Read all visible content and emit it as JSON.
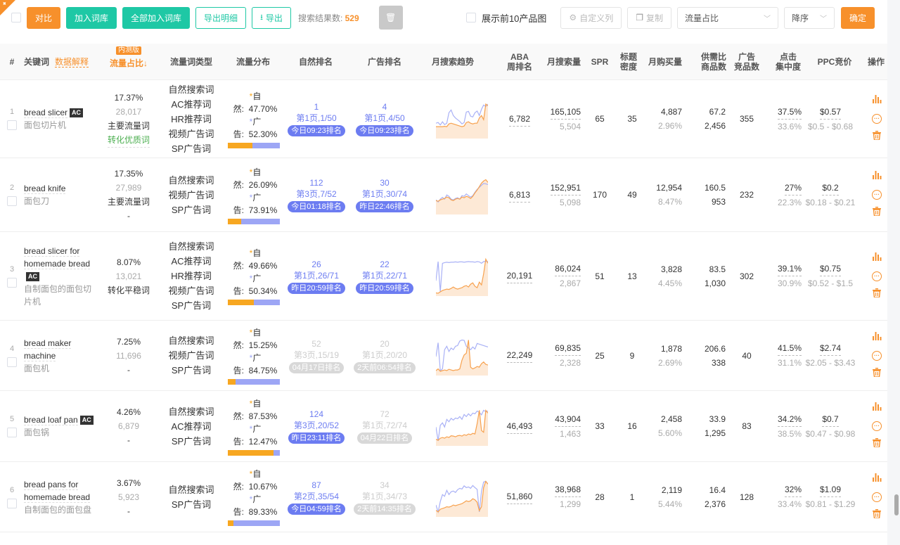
{
  "toolbar": {
    "compare_label": "对比",
    "add_to_lib_label": "加入词库",
    "add_all_to_lib_label": "全部加入词库",
    "export_detail_label": "导出明细",
    "export_label": "导出",
    "result_count_label": "搜索结果数:",
    "result_count_value": "529",
    "show_top10_label": "展示前10产品图",
    "custom_columns_label": "自定义列",
    "copy_label": "复制",
    "sort_field_value": "流量占比",
    "sort_order_value": "降序",
    "confirm_label": "确定"
  },
  "colors": {
    "accent_orange": "#f7902b",
    "accent_green": "#1ec8a5",
    "rank_blue": "#6c7cf1",
    "organic_bar": "#f7a721",
    "ad_bar": "#9da6f5"
  },
  "header": {
    "index": "#",
    "keyword": "关键词",
    "data_explain": "数据解释",
    "beta_badge": "内测版",
    "traffic_share": "流量占比↓",
    "traffic_type": "流量词类型",
    "traffic_dist": "流量分布",
    "organic_rank": "自然排名",
    "ad_rank": "广告排名",
    "monthly_trend": "月搜索趋势",
    "aba_rank_1": "ABA",
    "aba_rank_2": "周排名",
    "monthly_search": "月搜索量",
    "spr": "SPR",
    "title_density_1": "标题",
    "title_density_2": "密度",
    "monthly_purchase": "月购买量",
    "supply_demand_1": "供需比",
    "supply_demand_2": "商品数",
    "ad_products_1": "广告",
    "ad_products_2": "竞品数",
    "click_conc_1": "点击",
    "click_conc_2": "集中度",
    "ppc": "PPC竞价",
    "ops": "操作"
  },
  "dist_labels": {
    "organic": "自然:",
    "ad": "广告:"
  },
  "rows": [
    {
      "index": "1",
      "keyword": "bread slicer",
      "ac": true,
      "keyword_cn": "面包切片机",
      "share": "17.37%",
      "share_sub": "28,017",
      "share_tags": [
        "主要流量词",
        "转化优质词"
      ],
      "share_tag_colors": [
        "normal",
        "green"
      ],
      "types": [
        "自然搜索词",
        "AC推荐词",
        "HR推荐词",
        "视频广告词",
        "SP广告词"
      ],
      "organic_pct": "47.70%",
      "ad_pct": "52.30%",
      "organic_ratio": 0.477,
      "organic_rank": {
        "num": "1",
        "page": "第1页,1/50",
        "tag": "今日09:23排名",
        "active": true
      },
      "ad_rank": {
        "num": "4",
        "page": "第1页,4/50",
        "tag": "今日09:23排名",
        "active": true
      },
      "trend_blue": [
        40,
        42,
        35,
        44,
        36,
        40,
        70,
        78,
        62,
        55,
        50,
        45,
        38,
        42,
        72,
        74,
        60,
        58,
        70,
        75,
        62,
        80,
        92,
        88,
        95
      ],
      "trend_orange": [
        30,
        30,
        30,
        30,
        31,
        30,
        38,
        40,
        38,
        36,
        34,
        32,
        30,
        32,
        42,
        44,
        40,
        38,
        40,
        40,
        55,
        62,
        50,
        95,
        90
      ],
      "aba_rank": "6,782",
      "monthly_search": "165,105",
      "monthly_search_sub": "5,504",
      "spr": "65",
      "title_density": "35",
      "monthly_purchase": "4,887",
      "purchase_rate": "2.96%",
      "supply_demand": "67.2",
      "product_count": "2,456",
      "ad_products": "355",
      "click_conc": "37.5%",
      "click_conc_sub": "33.6%",
      "ppc": "$0.57",
      "ppc_range": "$0.5 - $0.68"
    },
    {
      "index": "2",
      "keyword": "bread knife",
      "ac": false,
      "keyword_cn": "面包刀",
      "share": "17.35%",
      "share_sub": "27,989",
      "share_tags": [
        "主要流量词",
        "-"
      ],
      "share_tag_colors": [
        "normal",
        "normal"
      ],
      "types": [
        "自然搜索词",
        "视频广告词",
        "SP广告词"
      ],
      "organic_pct": "26.09%",
      "ad_pct": "73.91%",
      "organic_ratio": 0.2609,
      "organic_rank": {
        "num": "112",
        "page": "第3页,7/52",
        "tag": "今日01:18排名",
        "active": true
      },
      "ad_rank": {
        "num": "30",
        "page": "第1页,30/74",
        "tag": "昨日22:46排名",
        "active": true
      },
      "trend_blue": [
        38,
        32,
        40,
        45,
        40,
        52,
        48,
        40,
        38,
        42,
        44,
        40,
        50,
        48,
        55,
        50,
        46,
        50,
        60,
        68,
        74,
        80,
        85,
        84,
        82
      ],
      "trend_orange": [
        36,
        34,
        38,
        40,
        42,
        46,
        44,
        38,
        36,
        40,
        42,
        40,
        46,
        44,
        48,
        46,
        42,
        48,
        58,
        66,
        76,
        86,
        92,
        96,
        88
      ],
      "aba_rank": "6,813",
      "monthly_search": "152,951",
      "monthly_search_sub": "5,098",
      "spr": "170",
      "title_density": "49",
      "monthly_purchase": "12,954",
      "purchase_rate": "8.47%",
      "supply_demand": "160.5",
      "product_count": "953",
      "ad_products": "232",
      "click_conc": "27%",
      "click_conc_sub": "22.3%",
      "ppc": "$0.2",
      "ppc_range": "$0.18 - $0.21"
    },
    {
      "index": "3",
      "keyword": "bread slicer for homemade bread",
      "ac": true,
      "keyword_cn": "自制面包的面包切片机",
      "share": "8.07%",
      "share_sub": "13,021",
      "share_tags": [
        "转化平稳词"
      ],
      "share_tag_colors": [
        "normal"
      ],
      "types": [
        "自然搜索词",
        "AC推荐词",
        "HR推荐词",
        "视频广告词",
        "SP广告词"
      ],
      "organic_pct": "49.66%",
      "ad_pct": "50.34%",
      "organic_ratio": 0.4966,
      "organic_rank": {
        "num": "26",
        "page": "第1页,26/71",
        "tag": "昨日20:59排名",
        "active": true
      },
      "ad_rank": {
        "num": "22",
        "page": "第1页,22/71",
        "tag": "昨日20:59排名",
        "active": true
      },
      "trend_blue": [
        40,
        95,
        8,
        90,
        92,
        93,
        92,
        93,
        93,
        94,
        93,
        94,
        94,
        93,
        94,
        95,
        94,
        94,
        93,
        95,
        94,
        90,
        95,
        96,
        95
      ],
      "trend_orange": [
        5,
        4,
        8,
        12,
        14,
        16,
        15,
        18,
        22,
        18,
        16,
        18,
        20,
        24,
        26,
        22,
        30,
        34,
        24,
        20,
        36,
        28,
        60,
        102,
        90
      ],
      "aba_rank": "20,191",
      "monthly_search": "86,024",
      "monthly_search_sub": "2,867",
      "spr": "51",
      "title_density": "13",
      "monthly_purchase": "3,828",
      "purchase_rate": "4.45%",
      "supply_demand": "83.5",
      "product_count": "1,030",
      "ad_products": "302",
      "click_conc": "39.1%",
      "click_conc_sub": "30.9%",
      "ppc": "$0.75",
      "ppc_range": "$0.52 - $1.5"
    },
    {
      "index": "4",
      "keyword": "bread maker machine",
      "ac": false,
      "keyword_cn": "面包机",
      "share": "7.25%",
      "share_sub": "11,696",
      "share_tags": [
        "-"
      ],
      "share_tag_colors": [
        "normal"
      ],
      "types": [
        "自然搜索词",
        "视频广告词",
        "SP广告词"
      ],
      "organic_pct": "15.25%",
      "ad_pct": "84.75%",
      "organic_ratio": 0.1525,
      "organic_rank": {
        "num": "52",
        "page": "第3页,15/19",
        "tag": "04月17日排名",
        "active": false
      },
      "ad_rank": {
        "num": "20",
        "page": "第1页,20/20",
        "tag": "2天前06:54排名",
        "active": false
      },
      "trend_blue": [
        50,
        90,
        10,
        15,
        70,
        80,
        65,
        75,
        70,
        80,
        82,
        95,
        98,
        97,
        80,
        75,
        70,
        78,
        72,
        88,
        86,
        84,
        82,
        80,
        78
      ],
      "trend_orange": [
        10,
        15,
        8,
        10,
        12,
        10,
        14,
        12,
        10,
        12,
        12,
        15,
        40,
        55,
        60,
        98,
        20,
        15,
        18,
        22,
        20,
        30,
        35,
        28,
        26
      ],
      "aba_rank": "22,249",
      "monthly_search": "69,835",
      "monthly_search_sub": "2,328",
      "spr": "25",
      "title_density": "9",
      "monthly_purchase": "1,878",
      "purchase_rate": "2.69%",
      "supply_demand": "206.6",
      "product_count": "338",
      "ad_products": "40",
      "click_conc": "41.5%",
      "click_conc_sub": "31.1%",
      "ppc": "$2.74",
      "ppc_range": "$2.05 - $3.43"
    },
    {
      "index": "5",
      "keyword": "bread loaf pan",
      "ac": true,
      "keyword_cn": "面包锅",
      "share": "4.26%",
      "share_sub": "6,879",
      "share_tags": [
        "-"
      ],
      "share_tag_colors": [
        "normal"
      ],
      "types": [
        "自然搜索词",
        "AC推荐词",
        "SP广告词"
      ],
      "organic_pct": "87.53%",
      "ad_pct": "12.47%",
      "organic_ratio": 0.8753,
      "organic_rank": {
        "num": "124",
        "page": "第3页,20/52",
        "tag": "昨日23:11排名",
        "active": true
      },
      "ad_rank": {
        "num": "72",
        "page": "第1页,72/74",
        "tag": "04月22日排名",
        "active": false
      },
      "trend_blue": [
        50,
        10,
        55,
        62,
        50,
        72,
        65,
        75,
        70,
        76,
        74,
        80,
        72,
        86,
        80,
        88,
        82,
        90,
        88,
        96,
        92,
        85,
        98,
        94,
        96
      ],
      "trend_orange": [
        15,
        12,
        18,
        20,
        18,
        22,
        20,
        25,
        24,
        22,
        25,
        26,
        24,
        28,
        26,
        30,
        28,
        32,
        30,
        60,
        98,
        40,
        35,
        98,
        90
      ],
      "aba_rank": "46,493",
      "monthly_search": "43,904",
      "monthly_search_sub": "1,463",
      "spr": "33",
      "title_density": "16",
      "monthly_purchase": "2,458",
      "purchase_rate": "5.60%",
      "supply_demand": "33.9",
      "product_count": "1,295",
      "ad_products": "83",
      "click_conc": "34.2%",
      "click_conc_sub": "38.5%",
      "ppc": "$0.7",
      "ppc_range": "$0.47 - $0.98"
    },
    {
      "index": "6",
      "keyword": "bread pans for homemade bread",
      "ac": false,
      "keyword_cn": "自制面包的面包盘",
      "share": "3.67%",
      "share_sub": "5,923",
      "share_tags": [
        "-"
      ],
      "share_tag_colors": [
        "normal"
      ],
      "types": [
        "自然搜索词",
        "SP广告词"
      ],
      "organic_pct": "10.67%",
      "ad_pct": "89.33%",
      "organic_ratio": 0.1067,
      "organic_rank": {
        "num": "87",
        "page": "第2页,35/54",
        "tag": "今日04:59排名",
        "active": true
      },
      "ad_rank": {
        "num": "34",
        "page": "第1页,34/73",
        "tag": "2天前14:35排名",
        "active": false
      },
      "trend_blue": [
        30,
        10,
        40,
        60,
        55,
        72,
        60,
        68,
        70,
        66,
        74,
        78,
        76,
        85,
        80,
        82,
        78,
        86,
        80,
        75,
        10,
        70,
        96,
        98,
        90
      ],
      "trend_orange": [
        15,
        10,
        18,
        20,
        22,
        25,
        24,
        26,
        30,
        28,
        30,
        32,
        34,
        38,
        42,
        40,
        42,
        48,
        45,
        38,
        14,
        25,
        80,
        98,
        90
      ],
      "aba_rank": "51,860",
      "monthly_search": "38,968",
      "monthly_search_sub": "1,299",
      "spr": "28",
      "title_density": "1",
      "monthly_purchase": "2,119",
      "purchase_rate": "5.44%",
      "supply_demand": "16.4",
      "product_count": "2,376",
      "ad_products": "128",
      "click_conc": "32%",
      "click_conc_sub": "33.4%",
      "ppc": "$1.09",
      "ppc_range": "$0.81 - $1.29"
    }
  ]
}
